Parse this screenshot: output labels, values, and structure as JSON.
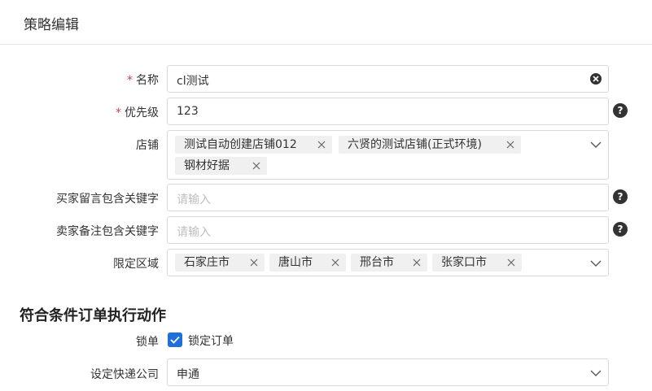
{
  "header": {
    "title": "策略编辑"
  },
  "form": {
    "name": {
      "label": "名称",
      "required": "*",
      "value": "cl测试"
    },
    "priority": {
      "label": "优先级",
      "required": "*",
      "value": "123",
      "help": "?"
    },
    "shop": {
      "label": "店铺",
      "tags": [
        "测试自动创建店铺012",
        "六贤的测试店铺(正式环境)",
        "钢材好据"
      ]
    },
    "buyer_keywords": {
      "label": "买家留言包含关键字",
      "placeholder": "请输入",
      "help": "?"
    },
    "seller_keywords": {
      "label": "卖家备注包含关键字",
      "placeholder": "请输入",
      "help": "?"
    },
    "region": {
      "label": "限定区域",
      "tags": [
        "石家庄市",
        "唐山市",
        "邢台市",
        "张家口市"
      ]
    }
  },
  "actions": {
    "title": "符合条件订单执行动作",
    "lock": {
      "label": "锁单",
      "checkbox_label": "锁定订单",
      "checked": true
    },
    "express": {
      "label": "设定快递公司",
      "value": "申通"
    }
  },
  "colors": {
    "accent": "#1e6fd9",
    "required": "#e4393c",
    "tag_bg": "#f0f0f0",
    "border": "#d9d9d9"
  }
}
